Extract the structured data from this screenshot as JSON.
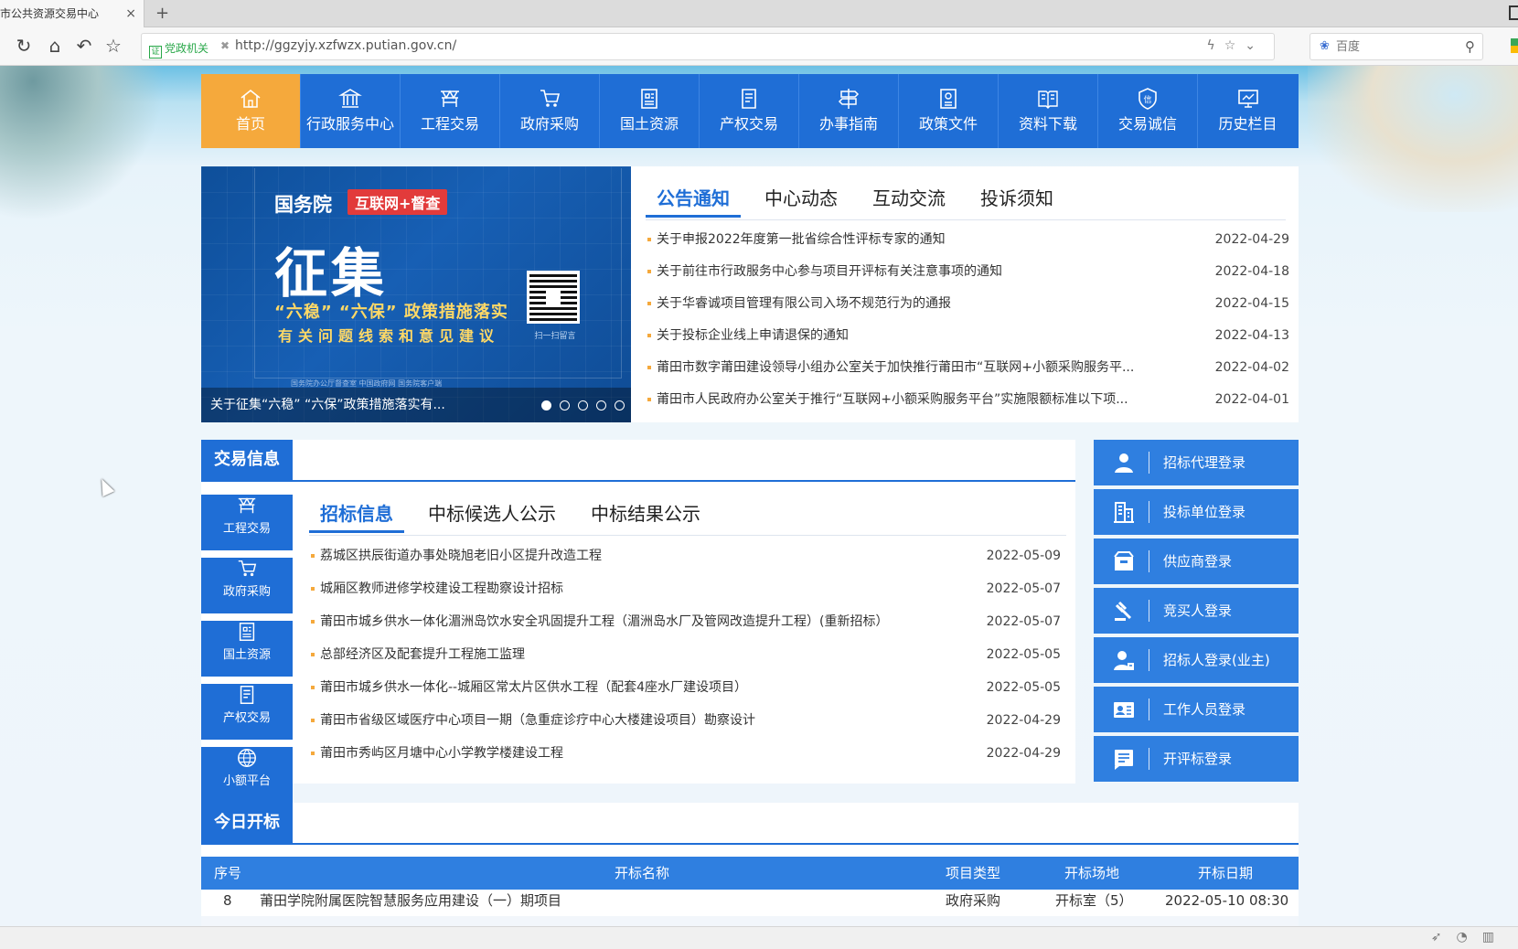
{
  "browser": {
    "tab_title": "市公共资源交易中心",
    "tab_close": "×",
    "new_tab": "+",
    "secure_badge": "证",
    "secure_label": "党政机关",
    "url": "http://ggzyjy.xzfwzx.putian.gov.cn/",
    "search_placeholder": "百度"
  },
  "nav": [
    {
      "label": "首页",
      "icon": "home-icon",
      "active": true
    },
    {
      "label": "行政服务中心",
      "icon": "building-icon"
    },
    {
      "label": "工程交易",
      "icon": "construction-icon"
    },
    {
      "label": "政府采购",
      "icon": "cart-icon"
    },
    {
      "label": "国土资源",
      "icon": "land-icon"
    },
    {
      "label": "产权交易",
      "icon": "document-icon"
    },
    {
      "label": "办事指南",
      "icon": "signpost-icon"
    },
    {
      "label": "政策文件",
      "icon": "policy-icon"
    },
    {
      "label": "资料下载",
      "icon": "book-icon"
    },
    {
      "label": "交易诚信",
      "icon": "shield-icon"
    },
    {
      "label": "历史栏目",
      "icon": "monitor-icon"
    }
  ],
  "banner": {
    "org": "国务院",
    "tag": "互联网+督查",
    "headline": "征集",
    "line1": "“六稳” “六保” 政策措施落实",
    "line2": "有关问题线索和意见建议",
    "qr_caption": "扫一扫留言",
    "logos": "国务院办公厅督查室    中国政府网    国务院客户端",
    "caption": "关于征集“六稳” “六保”政策措施落实有..."
  },
  "notice": {
    "tabs": [
      "公告通知",
      "中心动态",
      "互动交流",
      "投诉须知"
    ],
    "items": [
      {
        "title": "关于申报2022年度第一批省综合性评标专家的通知",
        "date": "2022-04-29"
      },
      {
        "title": "关于前往市行政服务中心参与项目开评标有关注意事项的通知",
        "date": "2022-04-18"
      },
      {
        "title": "关于华睿诚项目管理有限公司入场不规范行为的通报",
        "date": "2022-04-15"
      },
      {
        "title": "关于投标企业线上申请退保的通知",
        "date": "2022-04-13"
      },
      {
        "title": "莆田市数字莆田建设领导小组办公室关于加快推行莆田市“互联网+小额采购服务平...",
        "date": "2022-04-02"
      },
      {
        "title": "莆田市人民政府办公室关于推行“互联网+小额采购服务平台”实施限额标准以下项...",
        "date": "2022-04-01"
      }
    ]
  },
  "trade": {
    "title": "交易信息",
    "side": [
      {
        "label": "工程交易",
        "icon": "construction-icon"
      },
      {
        "label": "政府采购",
        "icon": "cart-icon"
      },
      {
        "label": "国土资源",
        "icon": "land-icon"
      },
      {
        "label": "产权交易",
        "icon": "document-icon"
      },
      {
        "label": "小额平台",
        "icon": "globe-icon"
      }
    ],
    "tabs": [
      "招标信息",
      "中标候选人公示",
      "中标结果公示"
    ],
    "items": [
      {
        "title": "荔城区拱辰街道办事处晓旭老旧小区提升改造工程",
        "date": "2022-05-09"
      },
      {
        "title": "城厢区教师进修学校建设工程勘察设计招标",
        "date": "2022-05-07"
      },
      {
        "title": "莆田市城乡供水一体化湄洲岛饮水安全巩固提升工程（湄洲岛水厂及管网改造提升工程）(重新招标）",
        "date": "2022-05-07"
      },
      {
        "title": "总部经济区及配套提升工程施工监理",
        "date": "2022-05-05"
      },
      {
        "title": "莆田市城乡供水一体化--城厢区常太片区供水工程（配套4座水厂建设项目）",
        "date": "2022-05-05"
      },
      {
        "title": "莆田市省级区域医疗中心项目一期（急重症诊疗中心大楼建设项目）勘察设计",
        "date": "2022-04-29"
      },
      {
        "title": "莆田市秀屿区月塘中心小学教学楼建设工程",
        "date": "2022-04-29"
      }
    ]
  },
  "logins": [
    {
      "label": "招标代理登录",
      "icon": "agent-icon"
    },
    {
      "label": "投标单位登录",
      "icon": "company-icon"
    },
    {
      "label": "供应商登录",
      "icon": "supplier-icon"
    },
    {
      "label": "竞买人登录",
      "icon": "gavel-icon"
    },
    {
      "label": "招标人登录(业主)",
      "icon": "owner-icon"
    },
    {
      "label": "工作人员登录",
      "icon": "staff-card-icon"
    },
    {
      "label": "开评标登录",
      "icon": "review-icon"
    }
  ],
  "today": {
    "title": "今日开标",
    "columns": [
      "序号",
      "开标名称",
      "项目类型",
      "开标场地",
      "开标日期"
    ],
    "rows": [
      {
        "no": "8",
        "name": "莆田学院附属医院智慧服务应用建设（一）期项目",
        "type": "政府采购",
        "site": "开标室（5）",
        "date": "2022-05-10 08:30"
      }
    ]
  }
}
